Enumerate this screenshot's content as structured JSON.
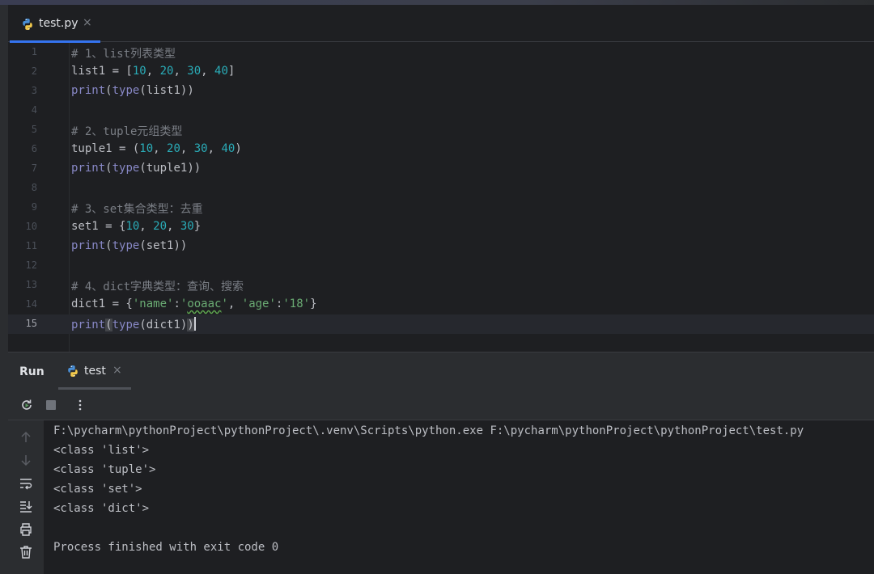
{
  "editor": {
    "tab_label": "test.py",
    "tab_close": "×",
    "lines": [
      {
        "n": "1"
      },
      {
        "n": "2"
      },
      {
        "n": "3"
      },
      {
        "n": "4"
      },
      {
        "n": "5"
      },
      {
        "n": "6"
      },
      {
        "n": "7"
      },
      {
        "n": "8"
      },
      {
        "n": "9"
      },
      {
        "n": "10"
      },
      {
        "n": "11"
      },
      {
        "n": "12"
      },
      {
        "n": "13"
      },
      {
        "n": "14"
      },
      {
        "n": "15"
      }
    ],
    "current_line": "15",
    "code": {
      "l1_comment": "# 1、list列表类型",
      "l2_var": "list1 = [",
      "l2_n1": "10",
      "l2_n2": "20",
      "l2_n3": "30",
      "l2_n4": "40",
      "l3_print": "print",
      "l3_type": "type",
      "l3_arg": "list1",
      "l5_comment": "# 2、tuple元组类型",
      "l6_var": "tuple1 = (",
      "l6_n1": "10",
      "l6_n2": "20",
      "l6_n3": "30",
      "l6_n4": "40",
      "l7_print": "print",
      "l7_type": "type",
      "l7_arg": "tuple1",
      "l9_comment": "# 3、set集合类型：去重",
      "l10_var": "set1 = {",
      "l10_n1": "10",
      "l10_n2": "20",
      "l10_n3": "30",
      "l11_print": "print",
      "l11_type": "type",
      "l11_arg": "set1",
      "l13_comment": "# 4、dict字典类型：查询、搜索",
      "l14_var": "dict1 = {",
      "l14_k1": "'name'",
      "l14_v1_q1": "'",
      "l14_v1": "ooaac",
      "l14_v1_q2": "'",
      "l14_k2": "'age'",
      "l14_v2": "'18'",
      "l15_print": "print",
      "l15_type": "type",
      "l15_arg": "dict1"
    }
  },
  "run": {
    "title": "Run",
    "tab_label": "test",
    "tab_close": "×",
    "toolbar": {
      "rerun_icon": "rerun-icon",
      "stop_icon": "stop-icon",
      "more_icon": "more-vertical-icon"
    },
    "sidebar_icons": [
      "arrow-up-icon",
      "arrow-down-icon",
      "soft-wrap-icon",
      "scroll-to-end-icon",
      "print-icon",
      "trash-icon"
    ],
    "console": {
      "command": "F:\\pycharm\\pythonProject\\pythonProject\\.venv\\Scripts\\python.exe F:\\pycharm\\pythonProject\\pythonProject\\test.py",
      "out1": "<class 'list'>",
      "out2": "<class 'tuple'>",
      "out3": "<class 'set'>",
      "out4": "<class 'dict'>",
      "finish": "Process finished with exit code 0"
    }
  },
  "colors": {
    "background": "#1e1f22",
    "panel": "#2b2d30",
    "accent": "#3574f0",
    "keyword_builtin": "#8888c6",
    "number": "#2aacb8",
    "string": "#6aab73",
    "comment": "#7a7e85"
  }
}
